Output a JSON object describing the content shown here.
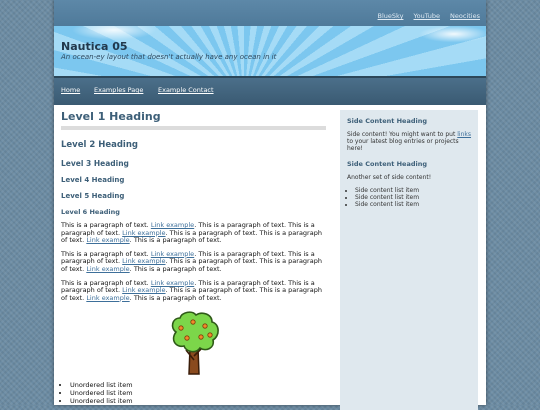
{
  "topbar": {
    "links": [
      "BlueSky",
      "YouTube",
      "Neocities"
    ]
  },
  "header": {
    "title": "Nautica 05",
    "tagline": "An ocean-ey layout that doesn't actually have any ocean in it"
  },
  "nav": {
    "items": [
      "Home",
      "Examples Page",
      "Example Contact"
    ]
  },
  "main": {
    "h1": "Level 1 Heading",
    "h2": "Level 2 Heading",
    "h3": "Level 3 Heading",
    "h4": "Level 4 Heading",
    "h5": "Level 5 Heading",
    "h6": "Level 6 Heading",
    "para_text": "This is a paragraph of text.",
    "link_text": "Link example",
    "list_items": [
      "Unordered list item",
      "Unordered list item",
      "Unordered list item"
    ]
  },
  "sidebar": {
    "block1": {
      "heading": "Side Content Heading",
      "text_before": "Side content! You might want to put",
      "link": "links",
      "text_after": "to your latest blog entries or projects here!"
    },
    "block2": {
      "heading": "Side Content Heading",
      "text": "Another set of side content!",
      "list": [
        "Side content list item",
        "Side content list item",
        "Side content list item"
      ]
    }
  },
  "colors": {
    "heading": "#3d5f78",
    "link": "#3d6f9a",
    "nav_bg": "#3a5a72",
    "sidebar_bg": "#dfe8ee",
    "page_bg": "#6b8ba3"
  },
  "icons": {
    "tree": "tree-illustration"
  }
}
